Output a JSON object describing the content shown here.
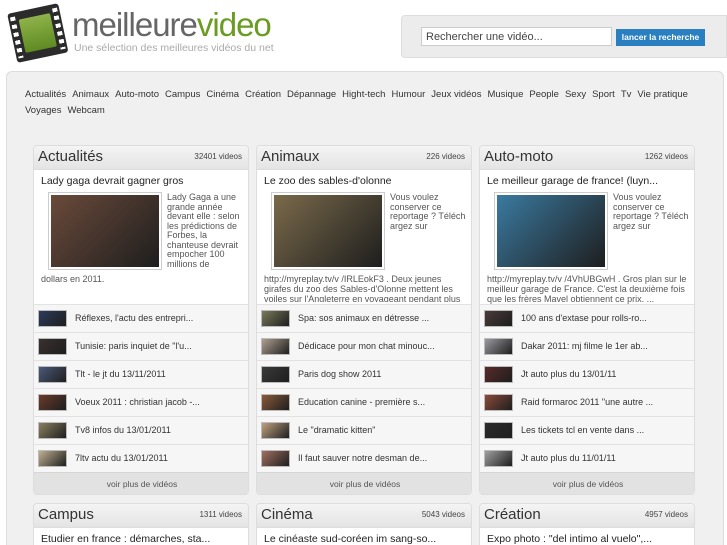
{
  "header": {
    "logo_main": "meilleure",
    "logo_accent": "video",
    "tagline": "Une sélection des meilleures vidéos du net",
    "search_placeholder": "Rechercher une vidéo...",
    "search_button": "lancer la recherche"
  },
  "nav": [
    "Actualités",
    "Animaux",
    "Auto-moto",
    "Campus",
    "Cinéma",
    "Création",
    "Dépannage",
    "Hight-tech",
    "Humour",
    "Jeux vidéos",
    "Musique",
    "People",
    "Sexy",
    "Sport",
    "Tv",
    "Vie pratique",
    "Voyages",
    "Webcam"
  ],
  "cards": [
    {
      "title": "Actualités",
      "count": "32401 videos",
      "feat_title": "Lady gaga devrait gagner gros",
      "feat_side": "Lady Gaga a une grande année devant elle : selon les prédictions de Forbes, la chanteuse devrait empocher 100 millions de",
      "feat_desc": "dollars en 2011.",
      "thumb_color": "#6a4a3a",
      "items": [
        "Réflexes, l'actu des entrepri...",
        "Tunisie: paris inquiet de \"l'u...",
        "Tlt - le jt du 13/11/2011",
        "Voeux 2011 : christian jacob -...",
        "Tv8 infos du 13/01/2011",
        "7ltv actu du 13/01/2011"
      ],
      "item_colors": [
        "#2d3a5a",
        "#3a3030",
        "#4a5a7a",
        "#6a3a2a",
        "#8a8060",
        "#c0b090"
      ],
      "more": "voir plus de vidéos"
    },
    {
      "title": "Animaux",
      "count": "226 videos",
      "feat_title": "Le zoo des sables-d'olonne",
      "feat_side": "Vous voulez conserver ce reportage ? Téléch argez sur",
      "feat_desc": "http://myreplay.tv/v /IRLEokF3 . Deux jeunes girafes du zoo des Sables-d'Olonne mettent les voiles sur l'Angleterre en voyageant pendant plus d...",
      "thumb_color": "#7a6a4a",
      "items": [
        "Spa: sos animaux en détresse ...",
        "Dédicace pour mon chat minouc...",
        "Paris dog show 2011",
        "Education canine - première s...",
        "Le \"dramatic kitten\"",
        "Il faut sauver notre desman de..."
      ],
      "item_colors": [
        "#7a7a5a",
        "#b0a090",
        "#3a3a3a",
        "#8a5a3a",
        "#c0a080",
        "#a07060"
      ],
      "more": "voir plus de vidéos"
    },
    {
      "title": "Auto-moto",
      "count": "1262 videos",
      "feat_title": "Le meilleur garage de france! (luyn...",
      "feat_side": "Vous voulez conserver ce reportage ? Téléch argez sur",
      "feat_desc": "http://myreplay.tv/v /4VhUBGwH . Gros plan sur le meilleur garage de France. C'est la deuxième fois que les frères Mavel obtiennent ce prix. ...",
      "thumb_color": "#3a7aa0",
      "items": [
        "100 ans d'extase pour rolls-ro...",
        "Dakar 2011: mj filme le 1er ab...",
        "Jt auto plus du 13/01/11",
        "Raid formaroc 2011 \"une autre ...",
        "Les tickets tcl en vente dans ...",
        "Jt auto plus du 11/01/11"
      ],
      "item_colors": [
        "#4a3a3a",
        "#9a9aa0",
        "#5a2a2a",
        "#8a4a3a",
        "#2a2a2a",
        "#a0a0a0"
      ],
      "more": "voir plus de vidéos"
    },
    {
      "title": "Campus",
      "count": "1311 videos",
      "feat_title": "Etudier en france : démarches, sta..."
    },
    {
      "title": "Cinéma",
      "count": "5043 videos",
      "feat_title": "Le cinéaste sud-coréen im sang-so..."
    },
    {
      "title": "Création",
      "count": "4957 videos",
      "feat_title": "Expo photo : \"del intimo al vuelo\",..."
    }
  ]
}
